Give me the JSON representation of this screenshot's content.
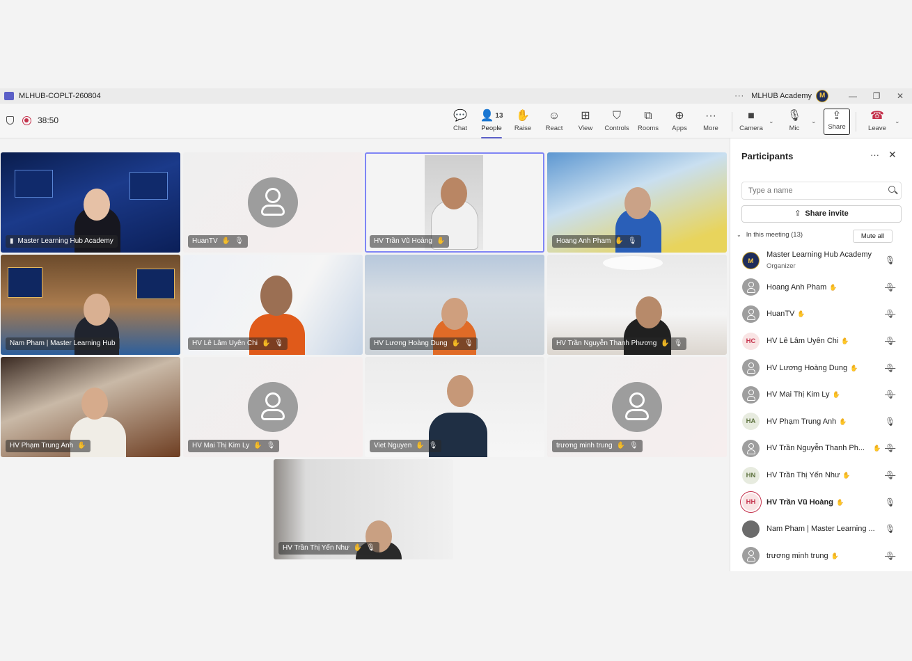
{
  "window": {
    "title": "MLHUB-COPLT-260804",
    "account": "MLHUB Academy"
  },
  "meeting": {
    "timer": "38:50"
  },
  "toolbar": {
    "chat": "Chat",
    "people": "People",
    "people_count": "13",
    "raise": "Raise",
    "react": "React",
    "view": "View",
    "controls": "Controls",
    "rooms": "Rooms",
    "apps": "Apps",
    "more": "More",
    "camera": "Camera",
    "mic": "Mic",
    "share": "Share",
    "leave": "Leave"
  },
  "tiles": [
    {
      "name": "Master Learning Hub Academy"
    },
    {
      "name": "HuanTV"
    },
    {
      "name": "HV Trần Vũ Hoàng"
    },
    {
      "name": "Hoang Anh Pham"
    },
    {
      "name": "Nam Pham | Master Learning Hub"
    },
    {
      "name": "HV Lê Lâm Uyên Chi"
    },
    {
      "name": "HV Lương Hoàng Dung"
    },
    {
      "name": "HV Trần Nguyễn Thanh Phương"
    },
    {
      "name": "HV Phạm Trung Anh"
    },
    {
      "name": "HV Mai Thị Kim Ly"
    },
    {
      "name": "Viet Nguyen"
    },
    {
      "name": "trương minh trung"
    },
    {
      "name": "HV Trần Thị Yến Như"
    }
  ],
  "panel": {
    "title": "Participants",
    "search_placeholder": "Type a name",
    "share_invite": "Share invite",
    "section_label": "In this meeting (13)",
    "mute_all": "Mute all",
    "participants": [
      {
        "name": "Master Learning Hub Academy",
        "role": "Organizer",
        "avatar": "M"
      },
      {
        "name": "Hoang Anh Pham",
        "avatar": ""
      },
      {
        "name": "HuanTV",
        "avatar": ""
      },
      {
        "name": "HV Lê Lâm Uyên Chi",
        "avatar": "HC"
      },
      {
        "name": "HV Lương Hoàng Dung",
        "avatar": ""
      },
      {
        "name": "HV Mai Thị Kim Ly",
        "avatar": ""
      },
      {
        "name": "HV Phạm Trung Anh",
        "avatar": "HA"
      },
      {
        "name": "HV Trần Nguyễn Thanh Ph...",
        "avatar": ""
      },
      {
        "name": "HV Trần Thị Yến Như",
        "avatar": "HN"
      },
      {
        "name": "HV Trần Vũ Hoàng",
        "avatar": "HH"
      },
      {
        "name": "Nam Pham | Master Learning ...",
        "avatar": ""
      },
      {
        "name": "trương minh trung",
        "avatar": ""
      }
    ]
  }
}
